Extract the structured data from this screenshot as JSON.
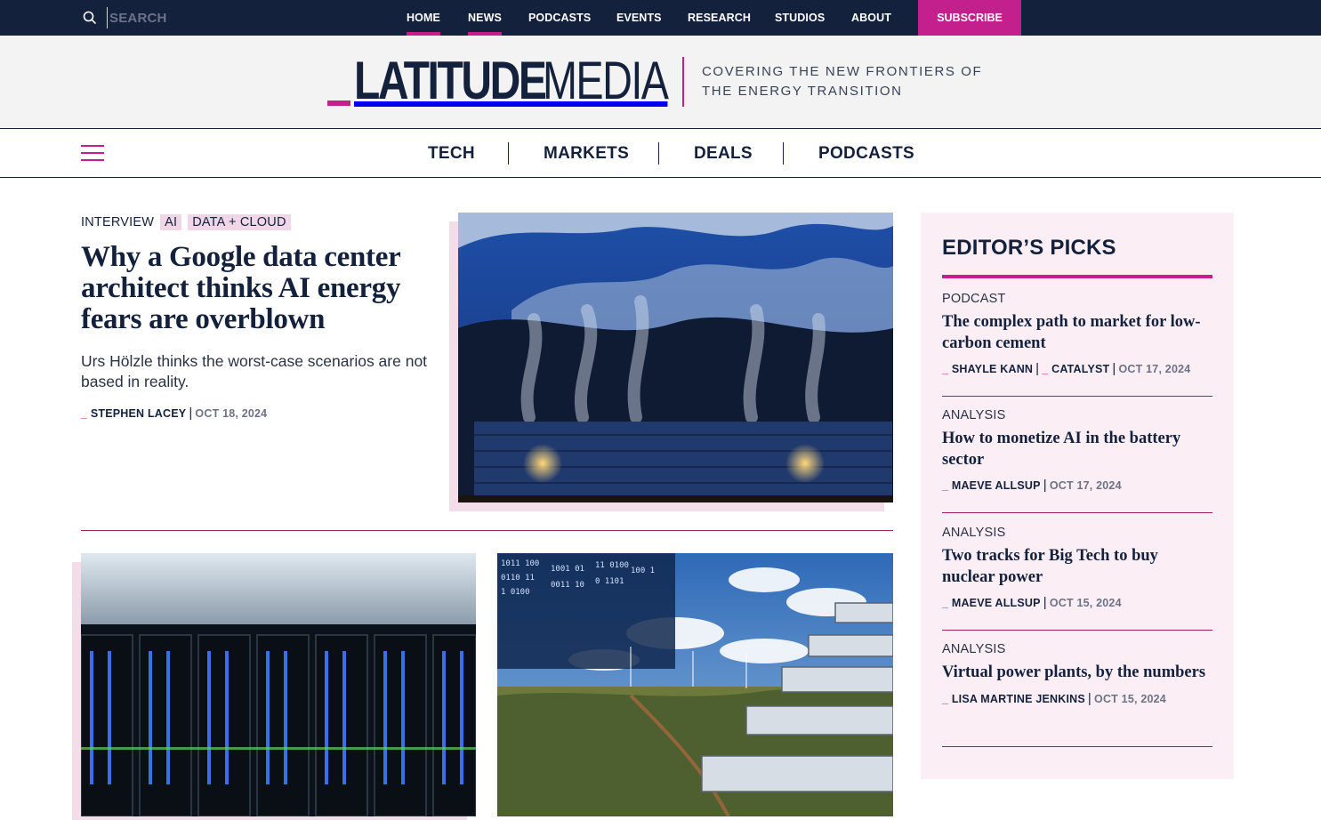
{
  "topbar": {
    "search_placeholder": "SEARCH",
    "nav": [
      {
        "label": "HOME",
        "active": true
      },
      {
        "label": "NEWS",
        "active": true
      },
      {
        "label": "PODCASTS",
        "active": false
      },
      {
        "label": "EVENTS",
        "active": false
      },
      {
        "label": "RESEARCH",
        "active": false
      },
      {
        "label": "STUDIOS",
        "active": false
      },
      {
        "label": "ABOUT",
        "active": false
      }
    ],
    "subscribe_label": "SUBSCRIBE"
  },
  "masthead": {
    "logo_part1": "LATITUDE",
    "logo_part2": "MEDIA",
    "tagline_line1": "COVERING THE NEW FRONTIERS OF",
    "tagline_line2": "THE ENERGY TRANSITION"
  },
  "section_nav": [
    "TECH",
    "MARKETS",
    "DEALS",
    "PODCASTS"
  ],
  "hero": {
    "type": "INTERVIEW",
    "tags": [
      "AI",
      "DATA + CLOUD"
    ],
    "title": "Why a Google data center architect thinks AI energy fears are overblown",
    "dek": "Urs Hölzle thinks the worst-case scenarios are not based in reality.",
    "author": "STEPHEN LACEY",
    "date": "OCT 18, 2024"
  },
  "editors_picks": {
    "heading": "EDITOR’S PICKS",
    "items": [
      {
        "type": "PODCAST",
        "title": "The complex path to market for low-carbon cement",
        "author": "SHAYLE KANN",
        "author2": "CATALYST",
        "date": "OCT 17, 2024"
      },
      {
        "type": "ANALYSIS",
        "title": "How to monetize AI in the battery sector",
        "author": "MAEVE ALLSUP",
        "date": "OCT 17, 2024"
      },
      {
        "type": "ANALYSIS",
        "title": "Two tracks for Big Tech to buy nuclear power",
        "author": "MAEVE ALLSUP",
        "date": "OCT 15, 2024"
      },
      {
        "type": "ANALYSIS",
        "title": "Virtual power plants, by the numbers",
        "author": "LISA MARTINE JENKINS",
        "date": "OCT 15, 2024"
      }
    ]
  },
  "colors": {
    "navy": "#14213d",
    "accent_pink": "#c4208d",
    "picks_bg": "#fbeef5",
    "masthead_bg": "#f3f3f3"
  }
}
